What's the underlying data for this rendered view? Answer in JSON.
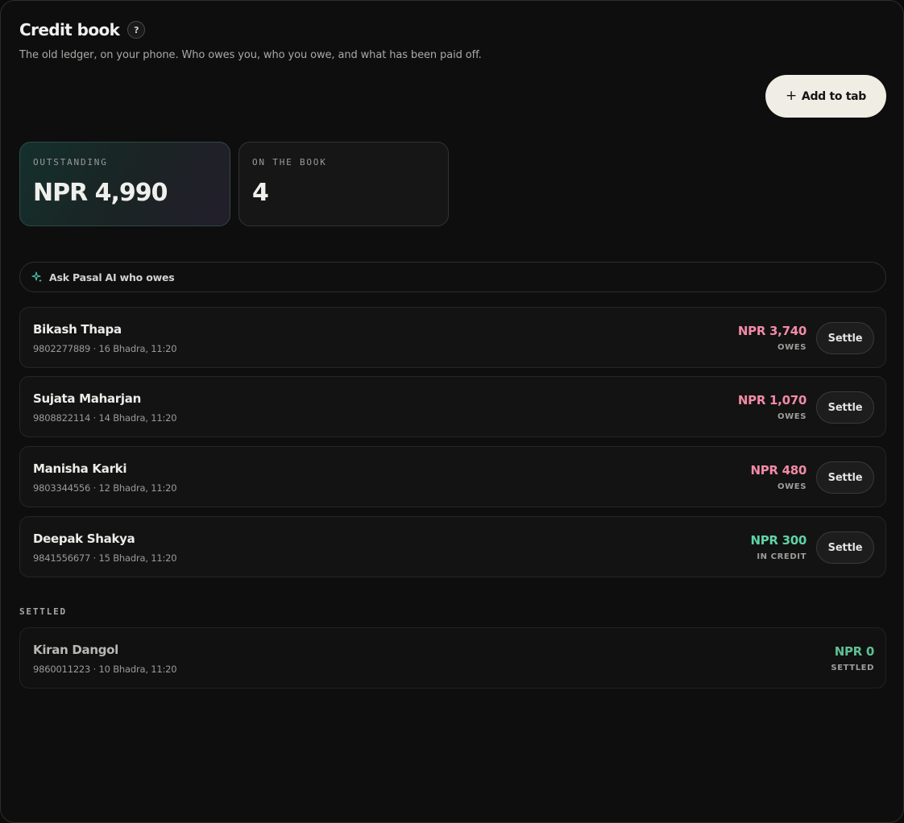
{
  "header": {
    "title": "Credit book",
    "help_label": "?",
    "subtitle": "The old ledger, on your phone. Who owes you, who you owe, and what has been paid off."
  },
  "actions": {
    "add_label": "Add to tab",
    "add_glyph": "+"
  },
  "stats": {
    "outstanding_label": "OUTSTANDING",
    "outstanding_value": "NPR 4,990",
    "book_label": "ON THE BOOK",
    "book_value": "4"
  },
  "ask": {
    "label": "Ask Pasal AI who owes",
    "icon": "sparkle-icon"
  },
  "entries": [
    {
      "name": "Bikash Thapa",
      "meta": "9802277889 · 16 Bhadra, 11:20",
      "amount": "NPR 3,740",
      "status": "OWES",
      "kind": "owes",
      "settle_label": "Settle"
    },
    {
      "name": "Sujata Maharjan",
      "meta": "9808822114 · 14 Bhadra, 11:20",
      "amount": "NPR 1,070",
      "status": "OWES",
      "kind": "owes",
      "settle_label": "Settle"
    },
    {
      "name": "Manisha Karki",
      "meta": "9803344556 · 12 Bhadra, 11:20",
      "amount": "NPR 480",
      "status": "OWES",
      "kind": "owes",
      "settle_label": "Settle"
    },
    {
      "name": "Deepak Shakya",
      "meta": "9841556677 · 15 Bhadra, 11:20",
      "amount": "NPR 300",
      "status": "IN CREDIT",
      "kind": "credit",
      "settle_label": "Settle"
    }
  ],
  "settled": {
    "label": "SETTLED",
    "items": [
      {
        "name": "Kiran Dangol",
        "meta": "9860011223 · 10 Bhadra, 11:20",
        "amount": "NPR 0",
        "status": "SETTLED"
      }
    ]
  },
  "colors": {
    "owes": "#f28aa6",
    "credit": "#5fd3a6",
    "button_light": "#efede4",
    "background": "#0e0e0e"
  }
}
